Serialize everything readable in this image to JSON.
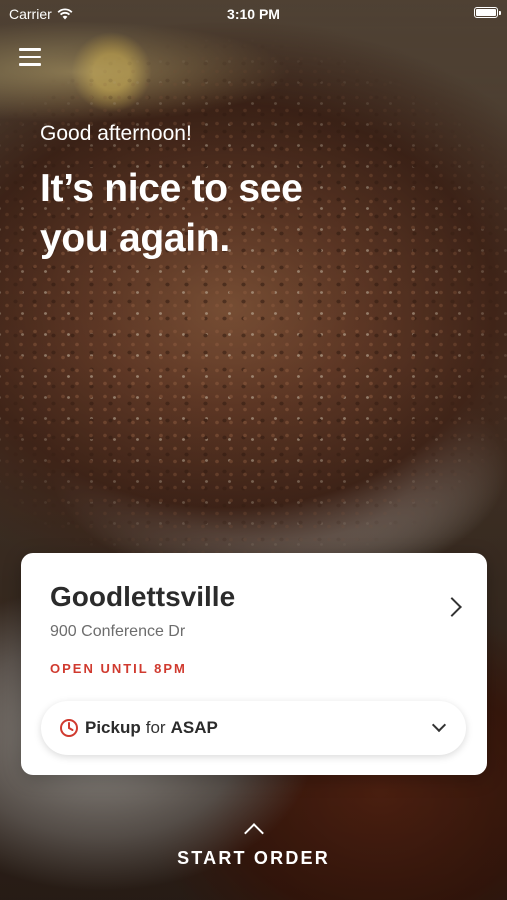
{
  "status_bar": {
    "carrier": "Carrier",
    "time": "3:10 PM"
  },
  "hero": {
    "greeting": "Good afternoon!",
    "headline": "It’s nice to see you again."
  },
  "location": {
    "name": "Goodlettsville",
    "address": "900 Conference Dr",
    "hours": "OPEN UNTIL 8PM"
  },
  "order_mode": {
    "mode": "Pickup",
    "connector": "for",
    "time": "ASAP"
  },
  "cta": {
    "label": "START ORDER"
  },
  "colors": {
    "accent": "#d03a2f",
    "card": "#ffffff",
    "text_dark": "#2b2b2b"
  },
  "icons": [
    "menu-icon",
    "wifi-icon",
    "battery-icon",
    "chevron-right-icon",
    "clock-icon",
    "chevron-down-icon",
    "chevron-up-icon"
  ]
}
